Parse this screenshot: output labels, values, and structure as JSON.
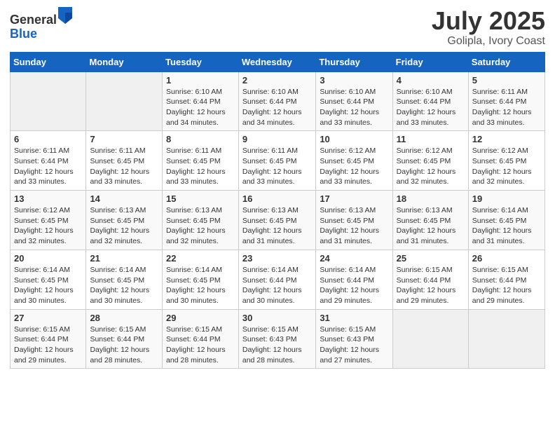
{
  "logo": {
    "general": "General",
    "blue": "Blue"
  },
  "title": {
    "month_year": "July 2025",
    "location": "Golipla, Ivory Coast"
  },
  "weekdays": [
    "Sunday",
    "Monday",
    "Tuesday",
    "Wednesday",
    "Thursday",
    "Friday",
    "Saturday"
  ],
  "weeks": [
    [
      {
        "day": "",
        "info": ""
      },
      {
        "day": "",
        "info": ""
      },
      {
        "day": "1",
        "info": "Sunrise: 6:10 AM\nSunset: 6:44 PM\nDaylight: 12 hours and 34 minutes."
      },
      {
        "day": "2",
        "info": "Sunrise: 6:10 AM\nSunset: 6:44 PM\nDaylight: 12 hours and 34 minutes."
      },
      {
        "day": "3",
        "info": "Sunrise: 6:10 AM\nSunset: 6:44 PM\nDaylight: 12 hours and 33 minutes."
      },
      {
        "day": "4",
        "info": "Sunrise: 6:10 AM\nSunset: 6:44 PM\nDaylight: 12 hours and 33 minutes."
      },
      {
        "day": "5",
        "info": "Sunrise: 6:11 AM\nSunset: 6:44 PM\nDaylight: 12 hours and 33 minutes."
      }
    ],
    [
      {
        "day": "6",
        "info": "Sunrise: 6:11 AM\nSunset: 6:44 PM\nDaylight: 12 hours and 33 minutes."
      },
      {
        "day": "7",
        "info": "Sunrise: 6:11 AM\nSunset: 6:45 PM\nDaylight: 12 hours and 33 minutes."
      },
      {
        "day": "8",
        "info": "Sunrise: 6:11 AM\nSunset: 6:45 PM\nDaylight: 12 hours and 33 minutes."
      },
      {
        "day": "9",
        "info": "Sunrise: 6:11 AM\nSunset: 6:45 PM\nDaylight: 12 hours and 33 minutes."
      },
      {
        "day": "10",
        "info": "Sunrise: 6:12 AM\nSunset: 6:45 PM\nDaylight: 12 hours and 33 minutes."
      },
      {
        "day": "11",
        "info": "Sunrise: 6:12 AM\nSunset: 6:45 PM\nDaylight: 12 hours and 32 minutes."
      },
      {
        "day": "12",
        "info": "Sunrise: 6:12 AM\nSunset: 6:45 PM\nDaylight: 12 hours and 32 minutes."
      }
    ],
    [
      {
        "day": "13",
        "info": "Sunrise: 6:12 AM\nSunset: 6:45 PM\nDaylight: 12 hours and 32 minutes."
      },
      {
        "day": "14",
        "info": "Sunrise: 6:13 AM\nSunset: 6:45 PM\nDaylight: 12 hours and 32 minutes."
      },
      {
        "day": "15",
        "info": "Sunrise: 6:13 AM\nSunset: 6:45 PM\nDaylight: 12 hours and 32 minutes."
      },
      {
        "day": "16",
        "info": "Sunrise: 6:13 AM\nSunset: 6:45 PM\nDaylight: 12 hours and 31 minutes."
      },
      {
        "day": "17",
        "info": "Sunrise: 6:13 AM\nSunset: 6:45 PM\nDaylight: 12 hours and 31 minutes."
      },
      {
        "day": "18",
        "info": "Sunrise: 6:13 AM\nSunset: 6:45 PM\nDaylight: 12 hours and 31 minutes."
      },
      {
        "day": "19",
        "info": "Sunrise: 6:14 AM\nSunset: 6:45 PM\nDaylight: 12 hours and 31 minutes."
      }
    ],
    [
      {
        "day": "20",
        "info": "Sunrise: 6:14 AM\nSunset: 6:45 PM\nDaylight: 12 hours and 30 minutes."
      },
      {
        "day": "21",
        "info": "Sunrise: 6:14 AM\nSunset: 6:45 PM\nDaylight: 12 hours and 30 minutes."
      },
      {
        "day": "22",
        "info": "Sunrise: 6:14 AM\nSunset: 6:45 PM\nDaylight: 12 hours and 30 minutes."
      },
      {
        "day": "23",
        "info": "Sunrise: 6:14 AM\nSunset: 6:44 PM\nDaylight: 12 hours and 30 minutes."
      },
      {
        "day": "24",
        "info": "Sunrise: 6:14 AM\nSunset: 6:44 PM\nDaylight: 12 hours and 29 minutes."
      },
      {
        "day": "25",
        "info": "Sunrise: 6:15 AM\nSunset: 6:44 PM\nDaylight: 12 hours and 29 minutes."
      },
      {
        "day": "26",
        "info": "Sunrise: 6:15 AM\nSunset: 6:44 PM\nDaylight: 12 hours and 29 minutes."
      }
    ],
    [
      {
        "day": "27",
        "info": "Sunrise: 6:15 AM\nSunset: 6:44 PM\nDaylight: 12 hours and 29 minutes."
      },
      {
        "day": "28",
        "info": "Sunrise: 6:15 AM\nSunset: 6:44 PM\nDaylight: 12 hours and 28 minutes."
      },
      {
        "day": "29",
        "info": "Sunrise: 6:15 AM\nSunset: 6:44 PM\nDaylight: 12 hours and 28 minutes."
      },
      {
        "day": "30",
        "info": "Sunrise: 6:15 AM\nSunset: 6:43 PM\nDaylight: 12 hours and 28 minutes."
      },
      {
        "day": "31",
        "info": "Sunrise: 6:15 AM\nSunset: 6:43 PM\nDaylight: 12 hours and 27 minutes."
      },
      {
        "day": "",
        "info": ""
      },
      {
        "day": "",
        "info": ""
      }
    ]
  ]
}
